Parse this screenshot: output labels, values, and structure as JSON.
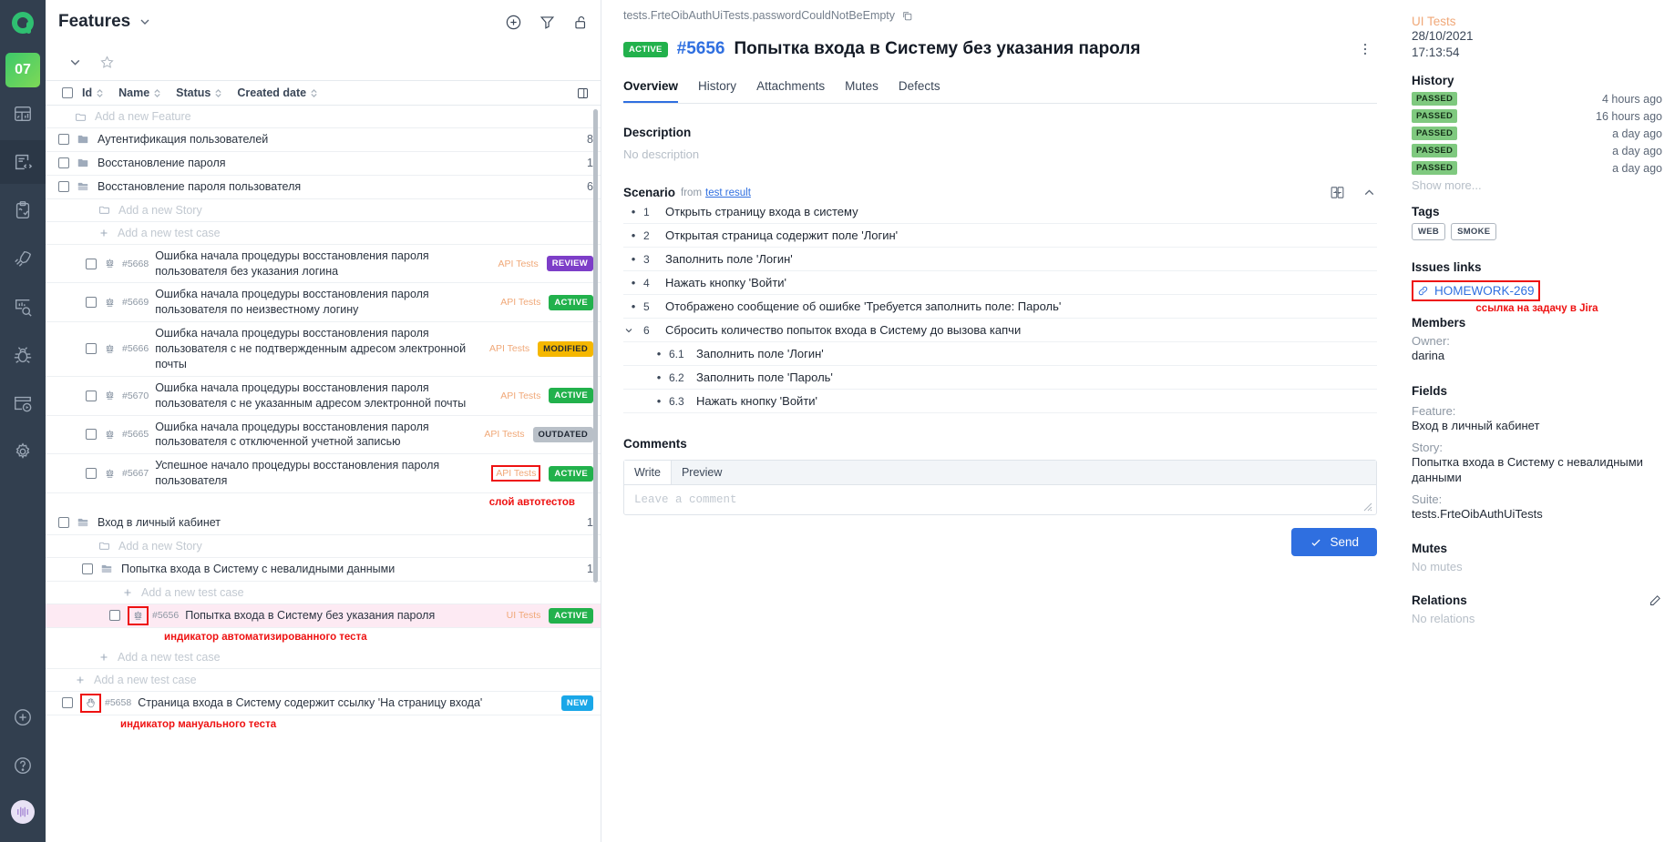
{
  "rail": {
    "badge_label": "07",
    "items": [
      {
        "name": "dashboard-icon"
      },
      {
        "name": "test-cases-icon",
        "active": true
      },
      {
        "name": "test-plans-icon"
      },
      {
        "name": "launches-icon"
      },
      {
        "name": "reports-icon"
      },
      {
        "name": "defects-icon"
      },
      {
        "name": "automation-icon"
      },
      {
        "name": "settings-icon"
      }
    ],
    "bottom": [
      {
        "name": "add-icon"
      },
      {
        "name": "help-icon"
      },
      {
        "name": "avatar"
      }
    ]
  },
  "list_panel": {
    "title": "Features",
    "columns": [
      "Id",
      "Name",
      "Status",
      "Created date"
    ],
    "rows": [
      {
        "type": "ghost",
        "depth": 0,
        "label": "Add a new Feature",
        "icon": "folder-plus-icon"
      },
      {
        "type": "folder",
        "depth": 0,
        "label": "Аутентификация пользователей",
        "count": "8"
      },
      {
        "type": "folder",
        "depth": 0,
        "label": "Восстановление пароля",
        "count": "1"
      },
      {
        "type": "folder",
        "depth": 0,
        "label": "Восстановление пароля пользователя",
        "count": "6",
        "open": true
      },
      {
        "type": "ghost",
        "depth": 1,
        "label": "Add a new Story",
        "icon": "folder-plus-icon"
      },
      {
        "type": "ghost",
        "depth": 1,
        "label": "Add a new test case",
        "icon": "plus-icon"
      },
      {
        "type": "test",
        "depth": 1,
        "id": "#5668",
        "label": "Ошибка начала процедуры восстановления пароля пользователя без указания логина",
        "layer": "API Tests",
        "status": "REVIEW",
        "kind": "auto"
      },
      {
        "type": "test",
        "depth": 1,
        "id": "#5669",
        "label": "Ошибка начала процедуры восстановления пароля пользователя по неизвестному логину",
        "layer": "API Tests",
        "status": "ACTIVE",
        "kind": "auto"
      },
      {
        "type": "test",
        "depth": 1,
        "id": "#5666",
        "label": "Ошибка начала процедуры восстановления пароля пользователя с не подтвержденным адресом электронной почты",
        "layer": "API Tests",
        "status": "MODIFIED",
        "kind": "auto"
      },
      {
        "type": "test",
        "depth": 1,
        "id": "#5670",
        "label": "Ошибка начала процедуры восстановления пароля пользователя с не указанным адресом электронной почты",
        "layer": "API Tests",
        "status": "ACTIVE",
        "kind": "auto"
      },
      {
        "type": "test",
        "depth": 1,
        "id": "#5665",
        "label": "Ошибка начала процедуры восстановления пароля пользователя с отключенной учетной записью",
        "layer": "API Tests",
        "status": "OUTDATED",
        "kind": "auto"
      },
      {
        "type": "test",
        "depth": 1,
        "id": "#5667",
        "label": "Успешное начало процедуры восстановления пароля пользователя",
        "layer": "API Tests",
        "status": "ACTIVE",
        "kind": "auto",
        "layer_highlight": true
      },
      {
        "type": "annotation",
        "label": "слой автотестов",
        "align": "right"
      },
      {
        "type": "folder",
        "depth": 0,
        "label": "Вход в личный кабинет",
        "count": "1",
        "open": true
      },
      {
        "type": "ghost",
        "depth": 1,
        "label": "Add a new Story",
        "icon": "folder-plus-icon"
      },
      {
        "type": "folder",
        "depth": 1,
        "label": "Попытка входа в Систему с невалидными данными",
        "count": "1",
        "open": true
      },
      {
        "type": "ghost",
        "depth": 2,
        "label": "Add a new test case",
        "icon": "plus-icon"
      },
      {
        "type": "test",
        "depth": 2,
        "id": "#5656",
        "label": "Попытка входа в Систему без указания пароля",
        "layer": "UI Tests",
        "status": "ACTIVE",
        "kind": "auto",
        "selected": true,
        "kind_highlight": true
      },
      {
        "type": "annotation",
        "label": "индикатор автоматизированного теста",
        "align": "left-inner"
      },
      {
        "type": "ghost",
        "depth": 1,
        "label": "Add a new test case",
        "icon": "plus-icon"
      },
      {
        "type": "ghost",
        "depth": 0,
        "label": "Add a new test case",
        "icon": "plus-icon"
      },
      {
        "type": "test",
        "depth": 0,
        "id": "#5658",
        "label": "Страница входа в Систему содержит ссылку 'На страницу входа'",
        "status": "NEW",
        "kind": "manual",
        "kind_highlight": true
      },
      {
        "type": "annotation",
        "label": "индикатор мануального теста",
        "align": "left-outer"
      }
    ]
  },
  "detail": {
    "breadcrumb": "tests.FrteOibAuthUiTests.passwordCouldNotBeEmpty",
    "status_badge": "ACTIVE",
    "case_id": "#5656",
    "case_title": "Попытка входа в Систему без указания пароля",
    "tabs": [
      {
        "label": "Overview",
        "active": true
      },
      {
        "label": "History",
        "active": false
      },
      {
        "label": "Attachments",
        "active": false
      },
      {
        "label": "Mutes",
        "active": false
      },
      {
        "label": "Defects",
        "active": false
      }
    ],
    "description": {
      "heading": "Description",
      "value": "No description"
    },
    "scenario": {
      "heading": "Scenario",
      "from_label": "from",
      "from_link": "test result",
      "steps": [
        {
          "num": "1",
          "text": "Открыть страницу входа в систему",
          "expandable": false
        },
        {
          "num": "2",
          "text": "Открытая страница содержит поле 'Логин'",
          "expandable": false
        },
        {
          "num": "3",
          "text": "Заполнить поле 'Логин'",
          "expandable": false
        },
        {
          "num": "4",
          "text": "Нажать кнопку 'Войти'",
          "expandable": false
        },
        {
          "num": "5",
          "text": "Отображено сообщение об ошибке 'Требуется заполнить поле: Пароль'",
          "expandable": false
        },
        {
          "num": "6",
          "text": "Сбросить количество попыток входа в Систему до вызова капчи",
          "expandable": true
        },
        {
          "num": "6.1",
          "text": "Заполнить поле 'Логин'",
          "sub": true
        },
        {
          "num": "6.2",
          "text": "Заполнить поле 'Пароль'",
          "sub": true
        },
        {
          "num": "6.3",
          "text": "Нажать кнопку 'Войти'",
          "sub": true
        }
      ]
    },
    "comments": {
      "heading": "Comments",
      "tabs": [
        {
          "label": "Write",
          "active": true
        },
        {
          "label": "Preview",
          "active": false
        }
      ],
      "placeholder": "Leave a comment",
      "send_label": "Send"
    }
  },
  "meta": {
    "layer": "UI Tests",
    "date": "28/10/2021",
    "time": "17:13:54",
    "history_heading": "History",
    "history": [
      {
        "status": "PASSED",
        "time": "4 hours ago"
      },
      {
        "status": "PASSED",
        "time": "16 hours ago"
      },
      {
        "status": "PASSED",
        "time": "a day ago"
      },
      {
        "status": "PASSED",
        "time": "a day ago"
      },
      {
        "status": "PASSED",
        "time": "a day ago"
      }
    ],
    "show_more": "Show more...",
    "tags_heading": "Tags",
    "tags": [
      "WEB",
      "SMOKE"
    ],
    "issues_heading": "Issues links",
    "issue_link": "HOMEWORK-269",
    "issue_annotation": "ссылка на задачу в Jira",
    "members_heading": "Members",
    "owner_label": "Owner:",
    "owner_value": "darina",
    "fields_heading": "Fields",
    "feature_label": "Feature:",
    "feature_value": "Вход в личный кабинет",
    "story_label": "Story:",
    "story_value": "Попытка входа в Систему с невалидными данными",
    "suite_label": "Suite:",
    "suite_value": "tests.FrteOibAuthUiTests",
    "mutes_heading": "Mutes",
    "mutes_value": "No mutes",
    "relations_heading": "Relations",
    "relations_value": "No relations"
  },
  "colors": {
    "rail_bg": "#323f4f",
    "accent_blue": "#2f6fe0",
    "status_active": "#22b14c",
    "status_review": "#7d3ec8",
    "status_modified": "#f5b700",
    "status_outdated": "#b9c0c8",
    "status_new": "#1aa7e8",
    "layer_orange": "#f0a878",
    "annotation_red": "#ee1111",
    "selected_row": "#fdeaf3"
  }
}
